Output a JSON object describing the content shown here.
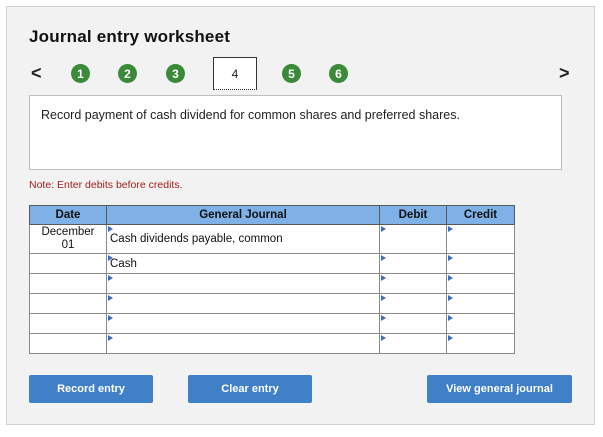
{
  "title": "Journal entry worksheet",
  "nav": {
    "prev": "<",
    "next": ">"
  },
  "steps": [
    "1",
    "2",
    "3",
    "4",
    "5",
    "6"
  ],
  "current_step": "4",
  "description": "Record payment of cash dividend for common shares and preferred shares.",
  "note": "Note: Enter debits before credits.",
  "table": {
    "headers": {
      "date": "Date",
      "general_journal": "General Journal",
      "debit": "Debit",
      "credit": "Credit"
    },
    "rows": [
      {
        "date_line1": "December",
        "date_line2": "01",
        "account": "Cash dividends payable, common",
        "debit": "",
        "credit": ""
      },
      {
        "date_line1": "",
        "date_line2": "",
        "account": "Cash",
        "debit": "",
        "credit": ""
      },
      {
        "date_line1": "",
        "date_line2": "",
        "account": "",
        "debit": "",
        "credit": ""
      },
      {
        "date_line1": "",
        "date_line2": "",
        "account": "",
        "debit": "",
        "credit": ""
      },
      {
        "date_line1": "",
        "date_line2": "",
        "account": "",
        "debit": "",
        "credit": ""
      },
      {
        "date_line1": "",
        "date_line2": "",
        "account": "",
        "debit": "",
        "credit": ""
      }
    ]
  },
  "buttons": {
    "record": "Record entry",
    "clear": "Clear entry",
    "view": "View general journal"
  },
  "colors": {
    "step_green": "#3a8a3a",
    "header_blue": "#7fb0e6",
    "button_blue": "#3f80c6",
    "note_red": "#a02020"
  }
}
